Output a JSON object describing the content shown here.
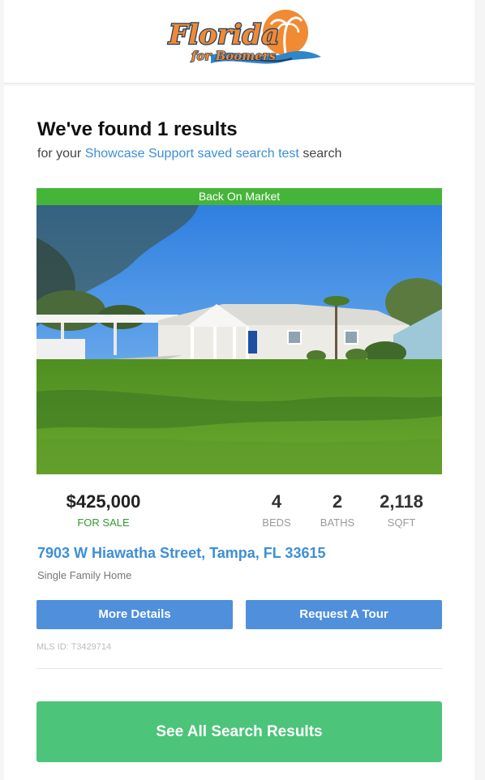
{
  "brand": {
    "logo_text_main": "Florida",
    "logo_text_sub": "for Boomers"
  },
  "results": {
    "headline": "We've found 1 results",
    "sub_prefix": "for your",
    "search_name": "Showcase Support saved search test",
    "sub_suffix": "search"
  },
  "listing": {
    "status_banner": "Back On Market",
    "price": "$425,000",
    "sale_status": "FOR SALE",
    "stats": [
      {
        "value": "4",
        "label": "BEDS"
      },
      {
        "value": "2",
        "label": "BATHS"
      },
      {
        "value": "2,118",
        "label": "SQFT"
      }
    ],
    "address": "7903 W Hiawatha Street, Tampa, FL 33615",
    "property_type": "Single Family Home",
    "more_details_label": "More Details",
    "request_tour_label": "Request A Tour",
    "mls_id": "MLS ID: T3429714"
  },
  "cta": {
    "see_all_label": "See All Search Results"
  },
  "colors": {
    "link_blue": "#3d8fd6",
    "banner_green": "#45b53a",
    "button_blue": "#4f8fdb",
    "cta_green": "#4cc47a",
    "logo_orange": "#f08a33",
    "logo_navy": "#1f3f66"
  }
}
